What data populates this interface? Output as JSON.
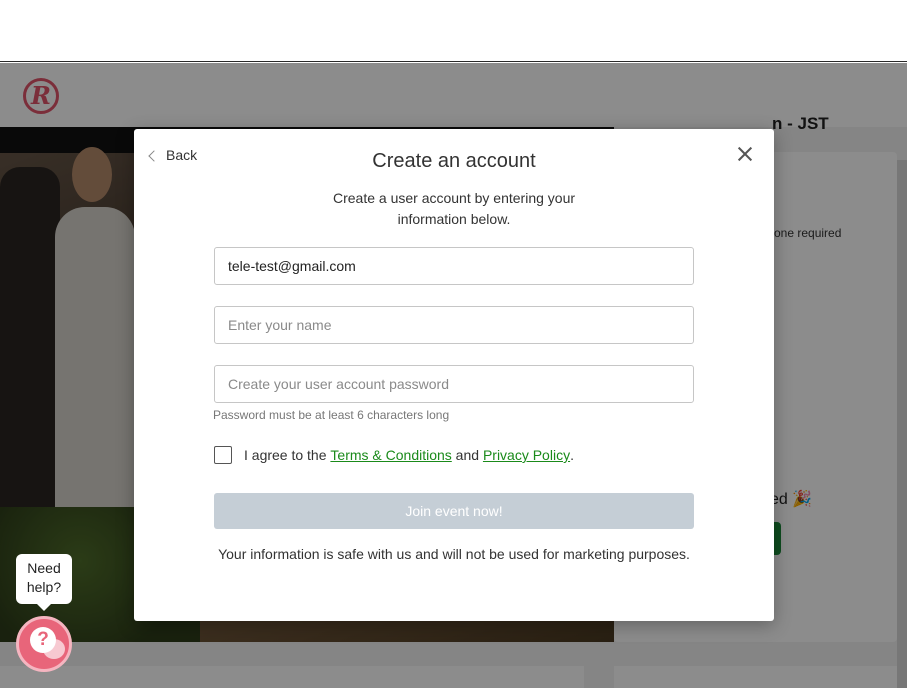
{
  "brand": {
    "logo_letter": "R",
    "accent_color": "#e1546b"
  },
  "background_page": {
    "event_title_fragment": "n - JST",
    "note_fragment": "one required",
    "joined_fragment": "ed 🎉"
  },
  "modal": {
    "back_label": "Back",
    "title": "Create an account",
    "subtitle": "Create a user account by entering your information below.",
    "email_value": "tele-test@gmail.com",
    "name_placeholder": "Enter your name",
    "password_placeholder": "Create your user account password",
    "password_hint": "Password must be at least 6 characters long",
    "agree_prefix": "I agree to the ",
    "terms_link": "Terms & Conditions",
    "agree_and": " and ",
    "privacy_link": "Privacy Policy",
    "agree_suffix": ".",
    "join_button": "Join event now!",
    "safe_note": "Your information is safe with us and will not be used for marketing purposes."
  },
  "help_widget": {
    "bubble_text": "Need help?",
    "icon_glyph": "?"
  }
}
